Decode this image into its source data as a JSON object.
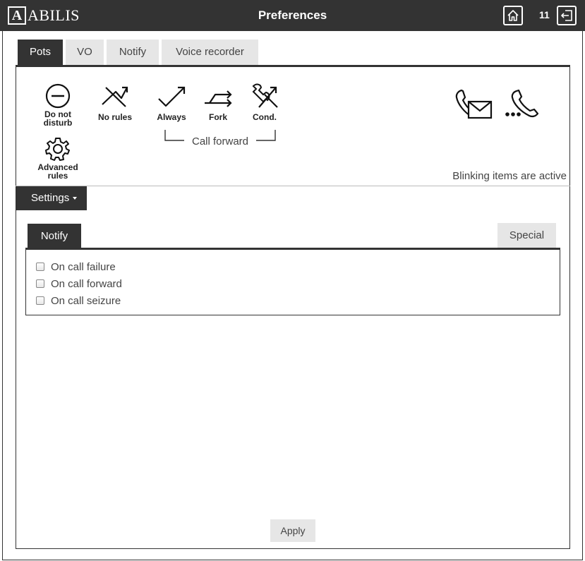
{
  "app": {
    "logo_letter": "A",
    "logo_text": "ABILIS",
    "title": "Preferences",
    "counter": "11"
  },
  "top_tabs": [
    {
      "label": "Pots",
      "active": true
    },
    {
      "label": "VO",
      "active": false
    },
    {
      "label": "Notify",
      "active": false
    },
    {
      "label": "Voice recorder",
      "active": false
    }
  ],
  "icons": {
    "do_not_disturb": "Do not disturb",
    "no_rules": "No rules",
    "always": "Always",
    "fork": "Fork",
    "cond": "Cond.",
    "advanced_rules": "Advanced rules",
    "call_forward_group": "Call forward",
    "voicemail_icon": "phone-mail-icon",
    "call_waiting_icon": "phone-dots-icon"
  },
  "blink_note": "Blinking items are active",
  "settings": {
    "label": "Settings"
  },
  "inner_tabs": {
    "notify": "Notify",
    "special": "Special"
  },
  "notify_options": [
    {
      "label": "On call failure",
      "checked": false
    },
    {
      "label": "On call forward",
      "checked": false
    },
    {
      "label": "On call seizure",
      "checked": false
    }
  ],
  "apply_label": "Apply",
  "colors": {
    "dark": "#333333",
    "tab_inactive": "#e6e6e6",
    "text": "#444444"
  }
}
